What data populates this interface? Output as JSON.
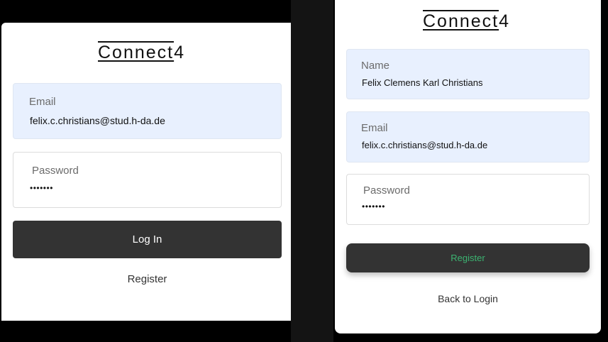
{
  "login": {
    "logo_main": "Connect",
    "logo_num": "4",
    "email_label": "Email",
    "email_value": "felix.c.christians@stud.h-da.de",
    "password_label": "Password",
    "password_value": "•••••••",
    "login_button": "Log In",
    "register_link": "Register"
  },
  "register": {
    "logo_main": "Connect",
    "logo_num": "4",
    "name_label": "Name",
    "name_value": "Felix Clemens Karl Christians",
    "email_label": "Email",
    "email_value": "felix.c.christians@stud.h-da.de",
    "password_label": "Password",
    "password_value": "•••••••",
    "register_button": "Register",
    "back_link": "Back to Login"
  },
  "colors": {
    "register_button_text": "#3cb371",
    "autofill_bg": "#e8f0fe",
    "button_bg": "#333333"
  }
}
